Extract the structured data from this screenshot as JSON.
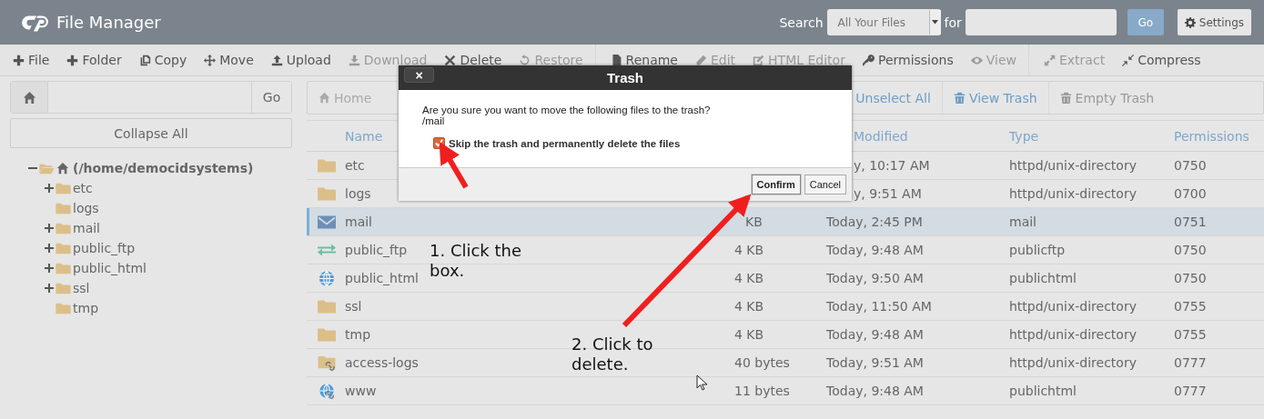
{
  "header": {
    "title": "File Manager",
    "search_label": "Search",
    "search_scope": "All Your Files",
    "for_label": "for",
    "go": "Go",
    "settings": "Settings"
  },
  "toolbar": [
    {
      "label": "File",
      "disabled": false
    },
    {
      "label": "Folder",
      "disabled": false
    },
    {
      "label": "Copy",
      "disabled": false
    },
    {
      "label": "Move",
      "disabled": false
    },
    {
      "label": "Upload",
      "disabled": false
    },
    {
      "label": "Download",
      "disabled": true
    },
    {
      "label": "Delete",
      "disabled": false
    },
    {
      "label": "Restore",
      "disabled": true
    },
    {
      "label": "Rename",
      "disabled": false
    },
    {
      "label": "Edit",
      "disabled": true
    },
    {
      "label": "HTML Editor",
      "disabled": true
    },
    {
      "label": "Permissions",
      "disabled": false
    },
    {
      "label": "View",
      "disabled": true
    },
    {
      "label": "Extract",
      "disabled": true
    },
    {
      "label": "Compress",
      "disabled": false
    }
  ],
  "path_bar": {
    "go": "Go"
  },
  "collapse_all": "Collapse All",
  "tree": [
    {
      "label": "(/home/democidsystems)",
      "expanded": true,
      "children": [
        {
          "label": "etc",
          "expanded": false
        },
        {
          "label": "logs"
        },
        {
          "label": "mail",
          "expanded": false
        },
        {
          "label": "public_ftp",
          "expanded": false
        },
        {
          "label": "public_html",
          "expanded": false
        },
        {
          "label": "ssl",
          "expanded": false
        },
        {
          "label": "tmp"
        }
      ]
    }
  ],
  "nav": [
    {
      "label": "Home",
      "disabled": false
    },
    {
      "label": "Unselect All",
      "disabled": false
    },
    {
      "label": "View Trash",
      "disabled": false
    },
    {
      "label": "Empty Trash",
      "disabled": true
    }
  ],
  "table": {
    "columns": [
      "Name",
      "Modified",
      "Type",
      "Permissions"
    ],
    "rows": [
      {
        "kind": "folder",
        "name": "etc",
        "modified": "y, 10:17 AM",
        "type": "httpd/unix-directory",
        "permissions": "0750",
        "selected": false
      },
      {
        "kind": "folder",
        "name": "logs",
        "modified": "y, 9:51 AM",
        "type": "httpd/unix-directory",
        "permissions": "0700",
        "selected": false
      },
      {
        "kind": "mail",
        "name": "mail",
        "size": "KB",
        "modified": "Today, 2:45 PM",
        "type": "mail",
        "permissions": "0751",
        "selected": true
      },
      {
        "kind": "ftp",
        "name": "public_ftp",
        "size": "4 KB",
        "modified": "Today, 9:48 AM",
        "type": "publicftp",
        "permissions": "0750",
        "selected": false
      },
      {
        "kind": "globe",
        "name": "public_html",
        "size": "4 KB",
        "modified": "Today, 9:50 AM",
        "type": "publichtml",
        "permissions": "0750",
        "selected": false
      },
      {
        "kind": "folder",
        "name": "ssl",
        "size": "4 KB",
        "modified": "Today, 11:50 AM",
        "type": "httpd/unix-directory",
        "permissions": "0755",
        "selected": false
      },
      {
        "kind": "folder",
        "name": "tmp",
        "size": "4 KB",
        "modified": "Today, 9:48 AM",
        "type": "httpd/unix-directory",
        "permissions": "0755",
        "selected": false
      },
      {
        "kind": "folder-link",
        "name": "access-logs",
        "size": "40 bytes",
        "modified": "Today, 9:51 AM",
        "type": "httpd/unix-directory",
        "permissions": "0777",
        "selected": false
      },
      {
        "kind": "globe-link",
        "name": "www",
        "size": "11 bytes",
        "modified": "Today, 9:48 AM",
        "type": "publichtml",
        "permissions": "0777",
        "selected": false
      }
    ]
  },
  "dialog": {
    "title": "Trash",
    "close": "×",
    "message": "Are you sure you want to move the following files to the trash?",
    "path": "/mail",
    "skip_label": "Skip the trash and permanently delete the files",
    "skip_checked": true,
    "buttons": [
      "Confirm",
      "Cancel"
    ]
  },
  "annotations": [
    "1. Click the box.",
    "2. Click to delete."
  ]
}
